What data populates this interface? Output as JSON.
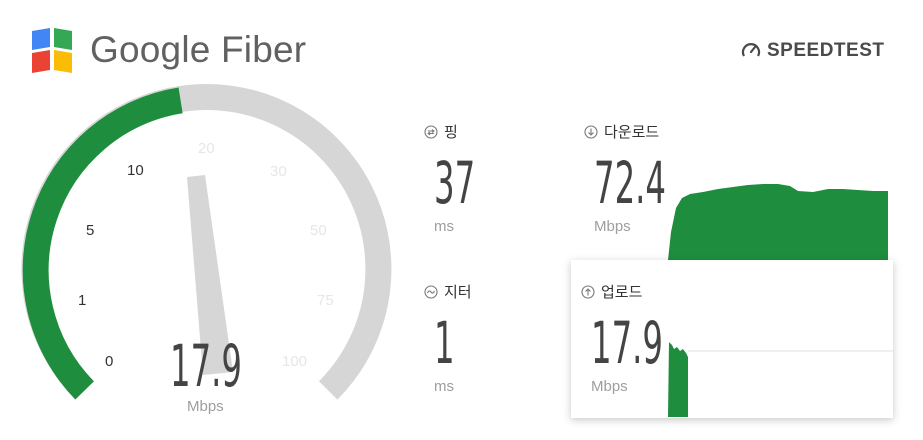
{
  "header": {
    "brand": "Google Fiber",
    "speedtest_label": "SPEEDTEST",
    "logo_colors": [
      "#4285F4",
      "#34A853",
      "#EA4335",
      "#FBBC05"
    ]
  },
  "gauge": {
    "ticks": [
      "0",
      "1",
      "5",
      "10",
      "20",
      "30",
      "50",
      "75",
      "100"
    ],
    "value": "17.9",
    "unit": "Mbps",
    "fill_color": "#1E8E3E",
    "track_color": "#D6D6D6"
  },
  "ping": {
    "label": "핑",
    "value": "37",
    "unit": "ms",
    "icon": "ping-icon"
  },
  "jitter": {
    "label": "지터",
    "value": "1",
    "unit": "ms",
    "icon": "jitter-icon"
  },
  "download": {
    "label": "다운로드",
    "value": "72.4",
    "unit": "Mbps",
    "icon": "arrow-down-icon"
  },
  "upload": {
    "label": "업로드",
    "value": "17.9",
    "unit": "Mbps",
    "icon": "arrow-up-icon"
  }
}
